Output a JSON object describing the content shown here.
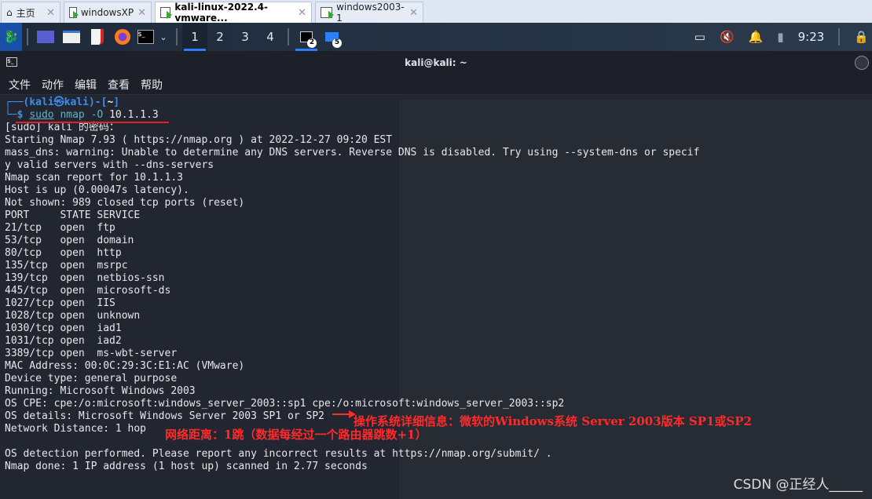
{
  "browser_tabs": [
    {
      "label": "主页",
      "icon": "home-icon",
      "active": false
    },
    {
      "label": "windowsXP",
      "icon": "vm-icon",
      "active": false
    },
    {
      "label": "kali-linux-2022.4-vmware...",
      "icon": "vm-icon",
      "active": true
    },
    {
      "label": "windows2003-1",
      "icon": "vm-icon",
      "active": false
    }
  ],
  "panel": {
    "workspaces": [
      "1",
      "2",
      "3",
      "4"
    ],
    "terminal_task_badge": "2",
    "folder_task_badge": "5",
    "clock": "9:23"
  },
  "terminal": {
    "title": "kali@kali: ~",
    "menu": [
      "文件",
      "动作",
      "编辑",
      "查看",
      "帮助"
    ],
    "prompt_user": "kali",
    "prompt_host": "kali",
    "prompt_dir": "~",
    "command_sudo": "sudo",
    "command_rest": " nmap -O",
    "command_target": " 10.1.1.3",
    "output": [
      "[sudo] kali 的密码：",
      "Starting Nmap 7.93 ( https://nmap.org ) at 2022-12-27 09:20 EST",
      "mass_dns: warning: Unable to determine any DNS servers. Reverse DNS is disabled. Try using --system-dns or specif",
      "y valid servers with --dns-servers",
      "Nmap scan report for 10.1.1.3",
      "Host is up (0.00047s latency).",
      "Not shown: 989 closed tcp ports (reset)",
      "PORT     STATE SERVICE",
      "21/tcp   open  ftp",
      "53/tcp   open  domain",
      "80/tcp   open  http",
      "135/tcp  open  msrpc",
      "139/tcp  open  netbios-ssn",
      "445/tcp  open  microsoft-ds",
      "1027/tcp open  IIS",
      "1028/tcp open  unknown",
      "1030/tcp open  iad1",
      "1031/tcp open  iad2",
      "3389/tcp open  ms-wbt-server",
      "MAC Address: 00:0C:29:3C:E1:AC (VMware)",
      "Device type: general purpose",
      "Running: Microsoft Windows 2003",
      "OS CPE: cpe:/o:microsoft:windows_server_2003::sp1 cpe:/o:microsoft:windows_server_2003::sp2",
      "OS details: Microsoft Windows Server 2003 SP1 or SP2",
      "Network Distance: 1 hop",
      "",
      "OS detection performed. Please report any incorrect results at https://nmap.org/submit/ .",
      "Nmap done: 1 IP address (1 host up) scanned in 2.77 seconds"
    ]
  },
  "annotations": {
    "os_details": "操作系统详细信息：微软的Windows系统 Server 2003版本 SP1或SP2",
    "network_distance": "网络距离：1跳（数据每经过一个路由器跳数+1）"
  },
  "watermark": "CSDN @正经人_____"
}
